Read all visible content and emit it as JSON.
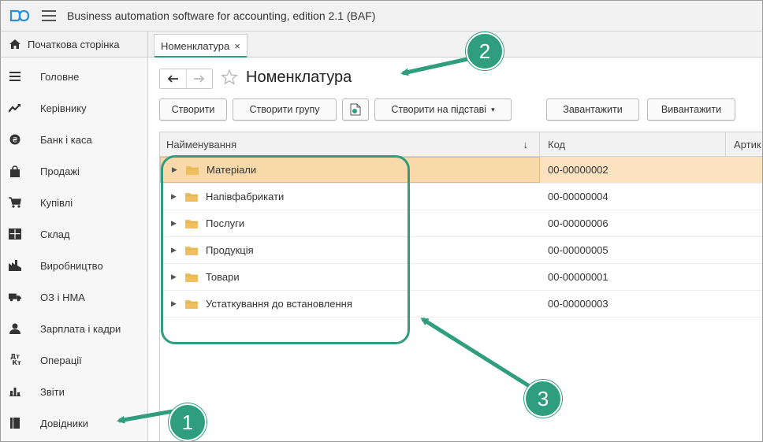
{
  "app": {
    "title": "Business automation software for accounting, edition 2.1  (BAF)"
  },
  "tabs": {
    "home": "Початкова сторінка",
    "active": "Номенклатура",
    "close": "×"
  },
  "sidebar": {
    "items": [
      {
        "label": "Головне",
        "icon": "list-icon"
      },
      {
        "label": "Керівнику",
        "icon": "trend-icon"
      },
      {
        "label": "Банк і каса",
        "icon": "coin-icon"
      },
      {
        "label": "Продажі",
        "icon": "shopping-bag-icon"
      },
      {
        "label": "Купівлі",
        "icon": "cart-icon"
      },
      {
        "label": "Склад",
        "icon": "warehouse-icon"
      },
      {
        "label": "Виробництво",
        "icon": "factory-icon"
      },
      {
        "label": "ОЗ і НМА",
        "icon": "truck-icon"
      },
      {
        "label": "Зарплата і кадри",
        "icon": "person-icon"
      },
      {
        "label": "Операції",
        "icon": "dt-kt-icon"
      },
      {
        "label": "Звіти",
        "icon": "bar-chart-icon"
      },
      {
        "label": "Довідники",
        "icon": "book-icon"
      }
    ],
    "dtkt_top": "Дт",
    "dtkt_bottom": "Кт"
  },
  "page": {
    "title": "Номенклатура"
  },
  "toolbar": {
    "create": "Створити",
    "create_group": "Створити групу",
    "create_based_on": "Створити на підставі",
    "download": "Завантажити",
    "upload": "Вивантажити"
  },
  "table": {
    "columns": [
      "Найменування",
      "Код",
      "Артик"
    ],
    "sort_indicator": "↓",
    "rows": [
      {
        "name": "Матеріали",
        "code": "00-00000002",
        "selected": true
      },
      {
        "name": "Напівфабрикати",
        "code": "00-00000004",
        "selected": false
      },
      {
        "name": "Послуги",
        "code": "00-00000006",
        "selected": false
      },
      {
        "name": "Продукція",
        "code": "00-00000005",
        "selected": false
      },
      {
        "name": "Товари",
        "code": "00-00000001",
        "selected": false
      },
      {
        "name": "Устаткування до встановлення",
        "code": "00-00000003",
        "selected": false
      }
    ]
  },
  "annotations": {
    "badges": [
      "1",
      "2",
      "3"
    ],
    "color": "#2e9e7e"
  },
  "colors": {
    "accent": "#2e9e7e",
    "selected_row": "#fbe3c1",
    "folder": "#f0c060"
  }
}
